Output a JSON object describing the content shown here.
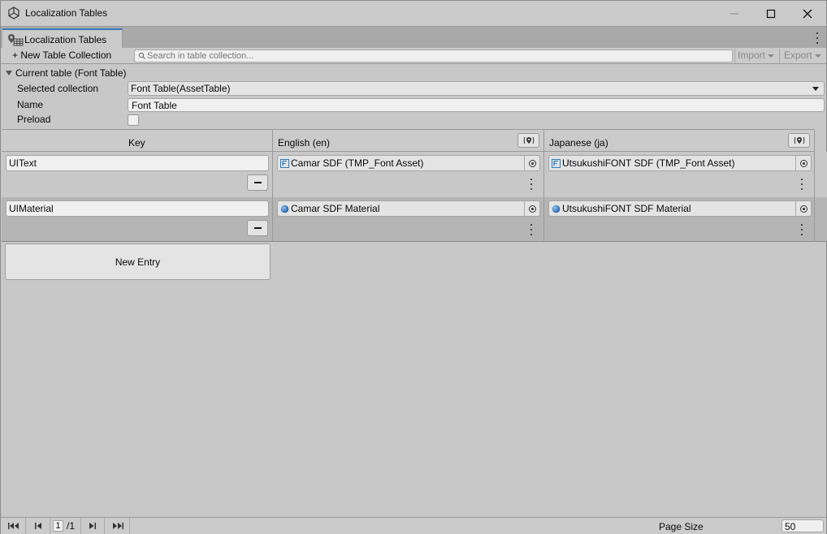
{
  "window": {
    "title": "Localization Tables",
    "icons": {
      "app": "unity-logo-icon",
      "minimize": "minimize-icon",
      "maximize": "maximize-icon",
      "close": "close-icon"
    }
  },
  "tab": {
    "label": "Localization Tables",
    "icon": "localization-tables-icon"
  },
  "toolbar": {
    "new_collection": "+ New Table Collection",
    "search_placeholder": "Search in table collection...",
    "import_label": "Import",
    "export_label": "Export"
  },
  "current_table": {
    "foldout_label": "Current table (Font Table)",
    "selected_collection_label": "Selected collection",
    "selected_collection_value": "Font Table(AssetTable)",
    "name_label": "Name",
    "name_value": "Font Table",
    "preload_label": "Preload",
    "preload_checked": false
  },
  "table": {
    "columns": [
      "Key",
      "English (en)",
      "Japanese (ja)"
    ],
    "rows": [
      {
        "key": "UIText",
        "english": {
          "value": "Camar SDF (TMP_Font Asset)",
          "icon": "font-asset-icon"
        },
        "japanese": {
          "value": "UtsukushiFONT SDF (TMP_Font Asset)",
          "icon": "font-asset-icon"
        }
      },
      {
        "key": "UIMaterial",
        "english": {
          "value": "Camar SDF Material",
          "icon": "material-sphere-icon"
        },
        "japanese": {
          "value": "UtsukushiFONT SDF Material",
          "icon": "material-sphere-icon"
        }
      }
    ],
    "new_entry_label": "New Entry"
  },
  "footer": {
    "page_current": "1",
    "page_total": "/1",
    "page_size_label": "Page Size",
    "page_size_value": "50"
  },
  "colors": {
    "accent": "#3a79bb",
    "background": "#c8c8c8",
    "font_asset_icon": "#2a7fc0",
    "material_icon": "#1f5fa8"
  }
}
